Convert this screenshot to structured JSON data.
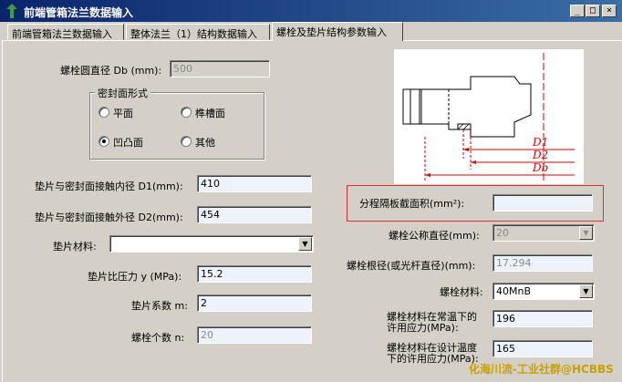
{
  "window": {
    "title": "前端管箱法兰数据输入",
    "btn_min": "_",
    "btn_max": "□",
    "btn_close": "×"
  },
  "tabs": [
    {
      "label": "前端管箱法兰数据输入"
    },
    {
      "label": "整体法兰（1）结构数据输入"
    },
    {
      "label": "螺栓及垫片结构参数输入"
    }
  ],
  "left": {
    "bolt_circle_label": "螺栓圆直径 Db (mm):",
    "bolt_circle_value": "500",
    "seal_group_title": "密封面形式",
    "seal_options": [
      "平面",
      "榫槽面",
      "凹凸面",
      "其他"
    ],
    "seal_selected": "凹凸面",
    "inner_label": "垫片与密封面接触内径 D1(mm):",
    "inner_value": "410",
    "outer_label": "垫片与密封面接触外径 D2(mm):",
    "outer_value": "454",
    "material_label": "垫片材料:",
    "material_value": "",
    "pressure_label": "垫片比压力 y (MPa):",
    "pressure_value": "15.2",
    "factor_label": "垫片系数 m:",
    "factor_value": "2",
    "bolt_count_label": "螺栓个数 n:",
    "bolt_count_value": "20"
  },
  "right": {
    "diagram_labels": [
      "D1",
      "D2",
      "Db"
    ],
    "partition_label": "分程隔板截面积(mm²):",
    "partition_value": "",
    "bolt_dia_label": "螺栓公称直径(mm):",
    "bolt_dia_value": "20",
    "root_dia_label": "螺栓根径(或光杆直径)(mm):",
    "root_dia_value": "17.294",
    "bolt_mat_label": "螺栓材料:",
    "bolt_mat_value": "40MnB",
    "stress_room_label_1": "螺栓材料在常温下的",
    "stress_room_label_2": "许用应力(MPa):",
    "stress_room_value": "196",
    "stress_design_label_1": "螺栓材料在设计温度",
    "stress_design_label_2": "下的许用应力(MPa):",
    "stress_design_value": "165"
  },
  "watermark": "化海川流-工业社群@HCBBS"
}
